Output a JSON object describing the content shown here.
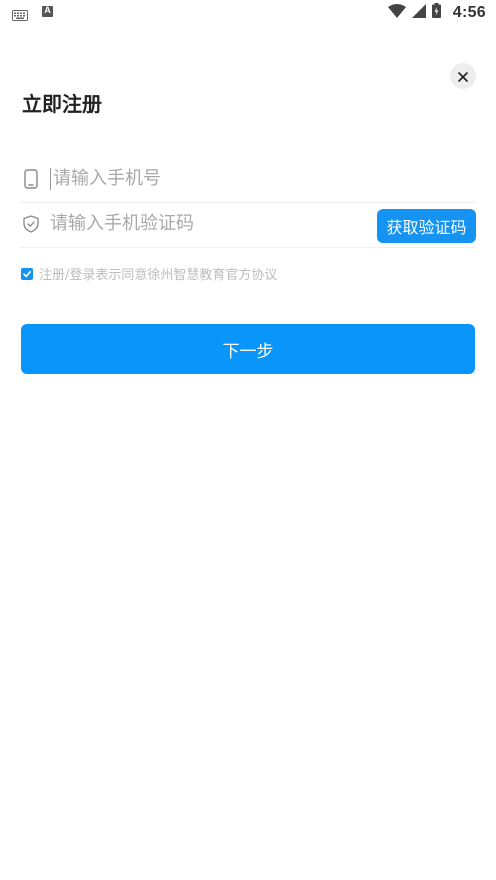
{
  "status_bar": {
    "time": "4:56",
    "icons": [
      "keyboard-icon",
      "a-notification-icon",
      "wifi-icon",
      "signal-icon",
      "battery-icon"
    ]
  },
  "header": {
    "title": "立即注册",
    "close_icon": "close-icon"
  },
  "form": {
    "phone": {
      "placeholder": "请输入手机号",
      "value": "",
      "icon": "phone-icon"
    },
    "code": {
      "placeholder": "请输入手机验证码",
      "value": "",
      "icon": "shield-icon"
    },
    "get_code_label": "获取验证码"
  },
  "agreement": {
    "checked": true,
    "text": "注册/登录表示同意徐州智慧教育官方协议"
  },
  "next_label": "下一步",
  "colors": {
    "accent": "#1493f2",
    "button": "#0a95fb",
    "placeholder": "#a8a8a8",
    "agreement_text": "#bdbdbd"
  }
}
